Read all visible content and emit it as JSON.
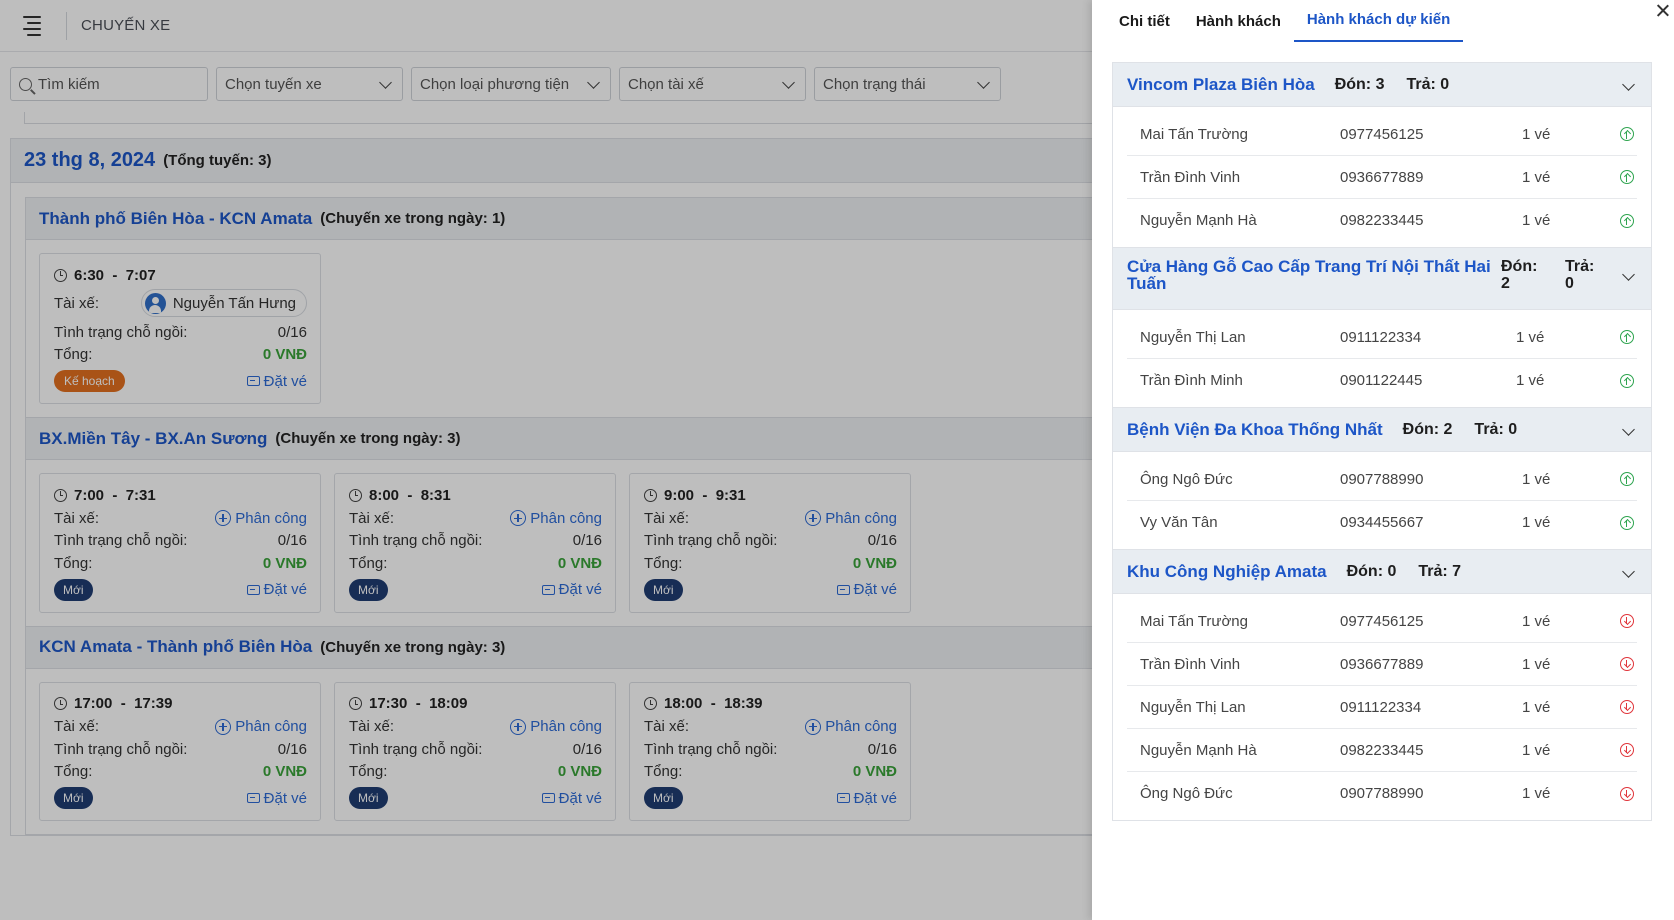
{
  "app": {
    "title": "CHUYẾN XE",
    "filters": {
      "search_placeholder": "Tìm kiếm",
      "route": "Chọn tuyến xe",
      "vehicle_type": "Chọn loại phương tiện",
      "driver": "Chọn tài xế",
      "status": "Chọn trạng thái"
    },
    "day": {
      "date": "23 thg 8, 2024",
      "total": "(Tổng tuyến: 3)"
    },
    "labels": {
      "driver": "Tài xế:",
      "seat_status": "Tình trạng chỗ ngồi:",
      "total": "Tổng:",
      "assign": "Phân công",
      "book": "Đặt vé"
    },
    "routes": [
      {
        "name": "Thành phố Biên Hòa - KCN Amata",
        "count": "(Chuyến xe trong ngày: 1)",
        "trips": [
          {
            "start": "6:30",
            "sep": "-",
            "end": "7:07",
            "driver": "Nguyễn Tấn Hưng",
            "seats": "0/16",
            "total": "0 VNĐ",
            "status": "Kế hoạch"
          }
        ]
      },
      {
        "name": "BX.Miền Tây - BX.An Sương",
        "count": "(Chuyến xe trong ngày: 3)",
        "trips": [
          {
            "start": "7:00",
            "sep": "-",
            "end": "7:31",
            "seats": "0/16",
            "total": "0 VNĐ",
            "status": "Mới"
          },
          {
            "start": "8:00",
            "sep": "-",
            "end": "8:31",
            "seats": "0/16",
            "total": "0 VNĐ",
            "status": "Mới"
          },
          {
            "start": "9:00",
            "sep": "-",
            "end": "9:31",
            "seats": "0/16",
            "total": "0 VNĐ",
            "status": "Mới"
          }
        ]
      },
      {
        "name": "KCN Amata - Thành phố Biên Hòa",
        "count": "(Chuyến xe trong ngày: 3)",
        "trips": [
          {
            "start": "17:00",
            "sep": "-",
            "end": "17:39",
            "seats": "0/16",
            "total": "0 VNĐ",
            "status": "Mới"
          },
          {
            "start": "17:30",
            "sep": "-",
            "end": "18:09",
            "seats": "0/16",
            "total": "0 VNĐ",
            "status": "Mới"
          },
          {
            "start": "18:00",
            "sep": "-",
            "end": "18:39",
            "seats": "0/16",
            "total": "0 VNĐ",
            "status": "Mới"
          }
        ]
      }
    ]
  },
  "drawer": {
    "tabs": [
      "Chi tiết",
      "Hành khách",
      "Hành khách dự kiến"
    ],
    "active_tab": 2,
    "stops": [
      {
        "name": "Vincom Plaza Biên Hòa",
        "pickup": "Đón: 3",
        "dropoff": "Trả: 0",
        "passengers": [
          {
            "name": "Mai Tấn Trường",
            "phone": "0977456125",
            "tickets": "1 vé",
            "dir": "up"
          },
          {
            "name": "Trần Đình Vinh",
            "phone": "0936677889",
            "tickets": "1 vé",
            "dir": "up"
          },
          {
            "name": "Nguyễn Mạnh Hà",
            "phone": "0982233445",
            "tickets": "1 vé",
            "dir": "up"
          }
        ]
      },
      {
        "name": "Cửa Hàng Gỗ Cao Cấp Trang Trí Nội Thất Hai Tuấn",
        "pickup_label": "Đón:",
        "pickup_value": "2",
        "dropoff_label": "Trả:",
        "dropoff_value": "0",
        "passengers": [
          {
            "name": "Nguyễn Thị Lan",
            "phone": "0911122334",
            "tickets": "1 vé",
            "dir": "up"
          },
          {
            "name": "Trần Đình Minh",
            "phone": "0901122445",
            "tickets": "1 vé",
            "dir": "up"
          }
        ]
      },
      {
        "name": "Bệnh Viện Đa Khoa Thống Nhất",
        "pickup": "Đón: 2",
        "dropoff": "Trả: 0",
        "passengers": [
          {
            "name": "Ông Ngô Đức",
            "phone": "0907788990",
            "tickets": "1 vé",
            "dir": "up"
          },
          {
            "name": "Vy Văn Tân",
            "phone": "0934455667",
            "tickets": "1 vé",
            "dir": "up"
          }
        ]
      },
      {
        "name": "Khu Công Nghiệp Amata",
        "pickup": "Đón: 0",
        "dropoff": "Trả: 7",
        "passengers": [
          {
            "name": "Mai Tấn Trường",
            "phone": "0977456125",
            "tickets": "1 vé",
            "dir": "down"
          },
          {
            "name": "Trần Đình Vinh",
            "phone": "0936677889",
            "tickets": "1 vé",
            "dir": "down"
          },
          {
            "name": "Nguyễn Thị Lan",
            "phone": "0911122334",
            "tickets": "1 vé",
            "dir": "down"
          },
          {
            "name": "Nguyễn Mạnh Hà",
            "phone": "0982233445",
            "tickets": "1 vé",
            "dir": "down"
          },
          {
            "name": "Ông Ngô Đức",
            "phone": "0907788990",
            "tickets": "1 vé",
            "dir": "down"
          }
        ]
      }
    ]
  },
  "colors": {
    "primary_blue": "#1d56c7",
    "money_green": "#3aa33a",
    "plan_orange": "#e3701f",
    "new_navy": "#1f3d73",
    "pickup_green": "#2ea44f",
    "dropoff_red": "#e0353b"
  },
  "icons": [
    "menu-icon",
    "search-icon",
    "chevron-down-icon",
    "clock-icon",
    "user-avatar-icon",
    "plus-circle-icon",
    "ticket-icon",
    "close-icon",
    "arrow-up-circle-icon",
    "arrow-down-circle-icon"
  ]
}
